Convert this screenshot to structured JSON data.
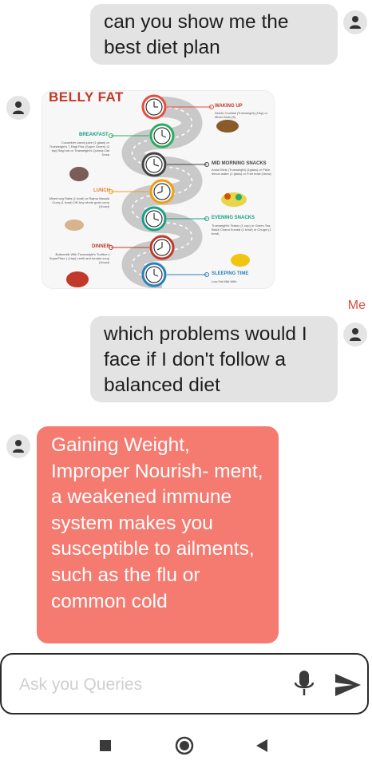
{
  "messages": {
    "q1": "can you show me the best diet plan",
    "q2": "which problems would I face if I don't follow a balanced diet",
    "a2": "Gaining Weight, Improper Nourish- ment,  a weakened immune system makes you susceptible to ailments, such as the flu or common cold",
    "me_label": "Me"
  },
  "infographic": {
    "title": "BELLY FAT",
    "sections": {
      "waking_up": "WAKING UP",
      "waking_up_text": "Seeds Cocktail (Trueweight) (1tsp) or Mixed Nuts (5)",
      "breakfast": "BREAKFAST",
      "breakfast_text": "Cucumber carrot juice (1 glass) or Trueweight's 7-Ragi Flax (Super Green) (2 tsp) Ragi roti or Trueweight's Quinoa Oat Dosa",
      "mid_morning": "MID MORNING SNACKS",
      "mid_morning_text": "Amla Drink (Trueweight) (1glass) or Plain lemon water (1 glass) or Fruit bowl (1bow)",
      "lunch": "LUNCH",
      "lunch_text": "Mixed veg Raita (1 bowl) or Rajma Masala Curry (1 bowl) OR Any whole grain curry (1bowl)",
      "evening": "EVENING SNACKS",
      "evening_text": "Trueweight's Teatox (1 cup) or Green Tea, Black Chana Sundal (1 bowl) or Chugni (1 bowl)",
      "dinner": "DINNER",
      "dinner_text": "Buttermilk With Trueweight's Trufibre ( SuperFibre ) (1tsp) Lentil and tomato soup (1bowl)",
      "sleeping": "SLEEPING TIME",
      "sleeping_text": "Low Fat Milk With"
    }
  },
  "input": {
    "placeholder": "Ask you Queries"
  },
  "icons": {
    "avatar": "person-icon",
    "mic": "microphone-icon",
    "send": "send-icon",
    "recents": "square-icon",
    "home": "circle-icon",
    "back": "triangle-icon"
  }
}
